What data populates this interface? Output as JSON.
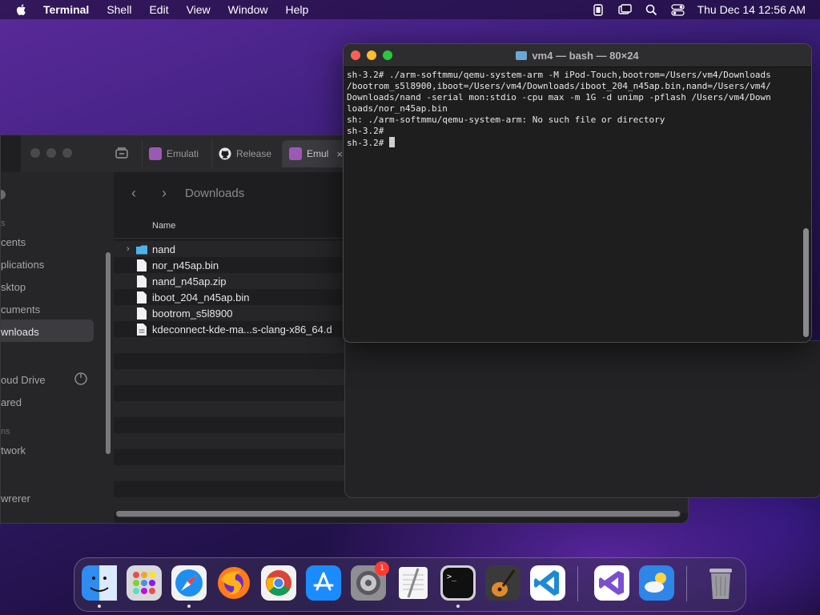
{
  "menubar": {
    "app_name": "Terminal",
    "items": [
      "Shell",
      "Edit",
      "View",
      "Window",
      "Help"
    ],
    "clock": "Thu Dec 14  12:56 AM",
    "status_icons": [
      "battery-icon",
      "screen-mirroring-icon",
      "spotlight-search-icon",
      "control-center-icon"
    ]
  },
  "browser": {
    "tabs": [
      {
        "label": "Emulati",
        "icon": "emulator-tab-icon"
      },
      {
        "label": "Release",
        "icon": "github-icon"
      },
      {
        "label": "Emul",
        "icon": "emulator-tab-icon"
      }
    ],
    "close_glyph": "×"
  },
  "finder": {
    "title": "Downloads",
    "column_name": "Name",
    "sidebar": [
      {
        "kind": "head",
        "label": "s"
      },
      {
        "kind": "item",
        "label": "cents"
      },
      {
        "kind": "item",
        "label": "plications"
      },
      {
        "kind": "item",
        "label": "sktop"
      },
      {
        "kind": "item",
        "label": "cuments"
      },
      {
        "kind": "item",
        "label": "wnloads",
        "selected": true
      },
      {
        "kind": "item",
        "label": "oud Drive"
      },
      {
        "kind": "item",
        "label": "ared"
      },
      {
        "kind": "head",
        "label": "ns"
      },
      {
        "kind": "item",
        "label": "twork"
      },
      {
        "kind": "item",
        "label": "wrerer"
      }
    ],
    "files": [
      {
        "name": "nand",
        "type": "folder"
      },
      {
        "name": "nor_n45ap.bin",
        "type": "file"
      },
      {
        "name": "nand_n45ap.zip",
        "type": "file"
      },
      {
        "name": "iboot_204_n45ap.bin",
        "type": "file"
      },
      {
        "name": "bootrom_s5l8900",
        "type": "file"
      },
      {
        "name": "kdeconnect-kde-ma...s-clang-x86_64.d",
        "type": "doc"
      }
    ]
  },
  "terminal": {
    "title": "vm4 — bash — 80×24",
    "lines": [
      "sh-3.2# ./arm-softmmu/qemu-system-arm -M iPod-Touch,bootrom=/Users/vm4/Downloads",
      "/bootrom_s5l8900,iboot=/Users/vm4/Downloads/iboot_204_n45ap.bin,nand=/Users/vm4/",
      "Downloads/nand -serial mon:stdio -cpu max -m 1G -d unimp -pflash /Users/vm4/Down",
      "loads/nor_n45ap.bin",
      "sh: ./arm-softmmu/qemu-system-arm: No such file or directory",
      "sh-3.2#",
      "sh-3.2# "
    ]
  },
  "dock": {
    "apps": [
      {
        "name": "Finder",
        "icon": "finder-icon",
        "color": "#2f8cf0",
        "running": true
      },
      {
        "name": "Launchpad",
        "icon": "launchpad-icon",
        "color": "#d8d8dc",
        "running": false
      },
      {
        "name": "Safari",
        "icon": "safari-icon",
        "color": "#1e8ff0",
        "running": true
      },
      {
        "name": "Firefox",
        "icon": "firefox-icon",
        "color": "#ff7a1a",
        "running": false
      },
      {
        "name": "Chrome",
        "icon": "chrome-icon",
        "color": "#f2f2f2",
        "running": false
      },
      {
        "name": "App Store",
        "icon": "app-store-icon",
        "color": "#1a8cff",
        "running": false
      },
      {
        "name": "System Preferences",
        "icon": "system-preferences-icon",
        "color": "#8e8e93",
        "running": false,
        "badge": "1"
      },
      {
        "name": "TextEdit",
        "icon": "textedit-icon",
        "color": "#f5f5f5",
        "running": false
      },
      {
        "name": "Terminal",
        "icon": "terminal-icon",
        "color": "#101010",
        "running": true
      },
      {
        "name": "GarageBand",
        "icon": "garageband-icon",
        "color": "#3a3a3c",
        "running": false
      },
      {
        "name": "Visual Studio Code",
        "icon": "vscode-icon",
        "color": "#ffffff",
        "running": false
      },
      {
        "name": "Visual Studio",
        "icon": "visual-studio-icon",
        "color": "#ffffff",
        "running": false
      },
      {
        "name": "Weather",
        "icon": "weather-icon",
        "color": "#2e86e8",
        "running": false
      },
      {
        "name": "Trash",
        "icon": "trash-icon",
        "color": "#9a9aa0",
        "running": false
      }
    ]
  }
}
